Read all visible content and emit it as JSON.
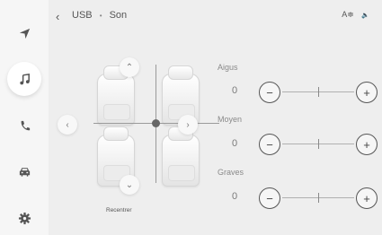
{
  "topbar": {
    "back_icon": "‹",
    "crumb1": "USB",
    "separator": "•",
    "crumb2": "Son",
    "right_icon": "A≑",
    "right_small": "🔈"
  },
  "sidebar": {
    "items": [
      {
        "icon": "navigation-icon"
      },
      {
        "icon": "music-icon",
        "active": true
      },
      {
        "icon": "phone-icon"
      },
      {
        "icon": "car-icon"
      },
      {
        "icon": "settings-icon"
      }
    ]
  },
  "seat_map": {
    "up_arrow": "⌃",
    "down_arrow": "⌄",
    "left_arrow": "‹",
    "right_arrow": "›",
    "recenter_label": "Recentrer"
  },
  "equalizer": [
    {
      "label": "Aigus",
      "value": "0",
      "minus": "−",
      "plus": "+"
    },
    {
      "label": "Moyen",
      "value": "0",
      "minus": "−",
      "plus": "+"
    },
    {
      "label": "Graves",
      "value": "0",
      "minus": "−",
      "plus": "+"
    }
  ]
}
